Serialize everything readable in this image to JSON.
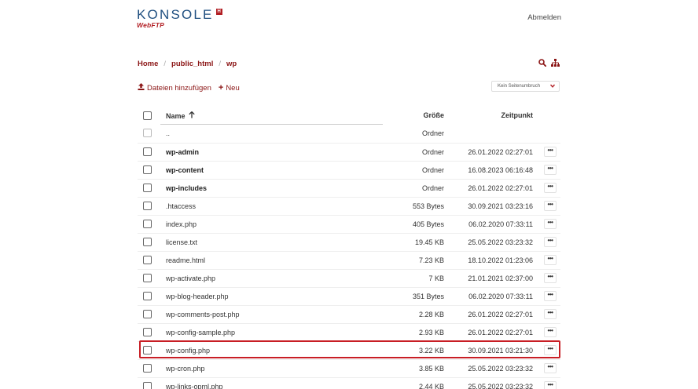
{
  "header": {
    "logo_main": "KONSOLE",
    "logo_badge": "H",
    "logo_sub": "WebFTP",
    "logout_label": "Abmelden"
  },
  "breadcrumb": [
    "Home",
    "public_html",
    "wp"
  ],
  "toolbar": {
    "add_files_label": "Dateien hinzufügen",
    "new_label": "Neu",
    "page_break_select": "Kein Seitenumbruch"
  },
  "table": {
    "headers": {
      "name": "Name",
      "size": "Größe",
      "time": "Zeitpunkt"
    },
    "rows": [
      {
        "name": "..",
        "size": "Ordner",
        "time": "",
        "dir": false,
        "menu": false
      },
      {
        "name": "wp-admin",
        "size": "Ordner",
        "time": "26.01.2022 02:27:01",
        "dir": true,
        "menu": true
      },
      {
        "name": "wp-content",
        "size": "Ordner",
        "time": "16.08.2023 06:16:48",
        "dir": true,
        "menu": true
      },
      {
        "name": "wp-includes",
        "size": "Ordner",
        "time": "26.01.2022 02:27:01",
        "dir": true,
        "menu": true
      },
      {
        "name": ".htaccess",
        "size": "553 Bytes",
        "time": "30.09.2021 03:23:16",
        "dir": false,
        "menu": true
      },
      {
        "name": "index.php",
        "size": "405 Bytes",
        "time": "06.02.2020 07:33:11",
        "dir": false,
        "menu": true
      },
      {
        "name": "license.txt",
        "size": "19.45 KB",
        "time": "25.05.2022 03:23:32",
        "dir": false,
        "menu": true
      },
      {
        "name": "readme.html",
        "size": "7.23 KB",
        "time": "18.10.2022 01:23:06",
        "dir": false,
        "menu": true
      },
      {
        "name": "wp-activate.php",
        "size": "7 KB",
        "time": "21.01.2021 02:37:00",
        "dir": false,
        "menu": true
      },
      {
        "name": "wp-blog-header.php",
        "size": "351 Bytes",
        "time": "06.02.2020 07:33:11",
        "dir": false,
        "menu": true
      },
      {
        "name": "wp-comments-post.php",
        "size": "2.28 KB",
        "time": "26.01.2022 02:27:01",
        "dir": false,
        "menu": true
      },
      {
        "name": "wp-config-sample.php",
        "size": "2.93 KB",
        "time": "26.01.2022 02:27:01",
        "dir": false,
        "menu": true
      },
      {
        "name": "wp-config.php",
        "size": "3.22 KB",
        "time": "30.09.2021 03:21:30",
        "dir": false,
        "menu": true
      },
      {
        "name": "wp-cron.php",
        "size": "3.85 KB",
        "time": "25.05.2022 03:23:32",
        "dir": false,
        "menu": true
      },
      {
        "name": "wp-links-opml.php",
        "size": "2.44 KB",
        "time": "25.05.2022 03:23:32",
        "dir": false,
        "menu": true
      }
    ]
  },
  "colors": {
    "brand_blue": "#1f4f80",
    "brand_red": "#b21f24",
    "link_red": "#8b1515",
    "highlight": "#c81e25"
  },
  "icons": {
    "search": "search-icon",
    "sitemap": "sitemap-icon",
    "upload": "upload-icon",
    "plus": "plus-icon",
    "sort": "arrow-up-icon",
    "menu": "ellipsis-icon"
  }
}
